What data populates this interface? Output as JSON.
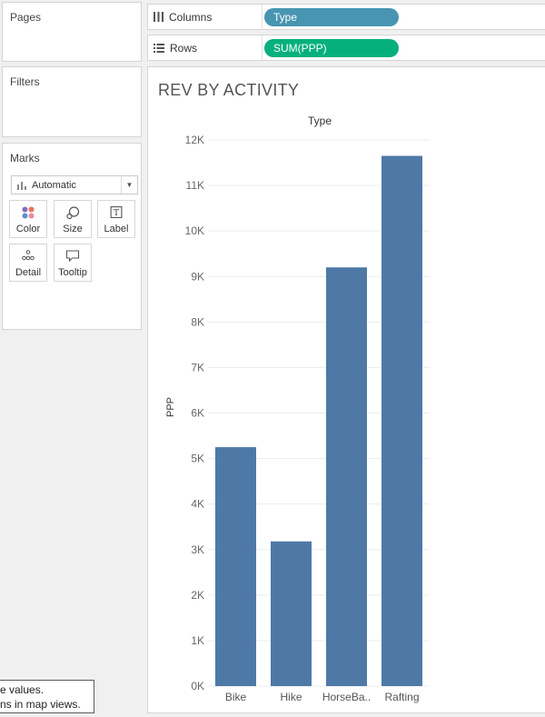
{
  "pages": {
    "title": "Pages"
  },
  "filters": {
    "title": "Filters"
  },
  "marks": {
    "title": "Marks",
    "mark_type": "Automatic",
    "buttons": {
      "color": "Color",
      "size": "Size",
      "label": "Label",
      "detail": "Detail",
      "tooltip": "Tooltip"
    }
  },
  "shelves": {
    "columns": {
      "label": "Columns",
      "pill": "Type"
    },
    "rows": {
      "label": "Rows",
      "pill": "SUM(PPP)"
    }
  },
  "colors": {
    "bar": "#4e79a7",
    "dimension_pill": "#4895b2",
    "measure_pill": "#06b07d"
  },
  "sheet": {
    "title": "REV BY ACTIVITY"
  },
  "tooltip": {
    "line1": "e values.",
    "line2": "ns in map views."
  },
  "chart_data": {
    "type": "bar",
    "title": "",
    "xlabel": "Type",
    "ylabel": "PPP",
    "categories": [
      "Bike",
      "Hike",
      "HorseBa..",
      "Rafting"
    ],
    "values": [
      5250,
      3180,
      9200,
      11650
    ],
    "ylim": [
      0,
      12000
    ],
    "yticks": [
      0,
      1000,
      2000,
      3000,
      4000,
      5000,
      6000,
      7000,
      8000,
      9000,
      10000,
      11000,
      12000
    ],
    "ytick_labels": [
      "0K",
      "1K",
      "2K",
      "3K",
      "4K",
      "5K",
      "6K",
      "7K",
      "8K",
      "9K",
      "10K",
      "11K",
      "12K"
    ],
    "grid": true,
    "legend": "none"
  }
}
